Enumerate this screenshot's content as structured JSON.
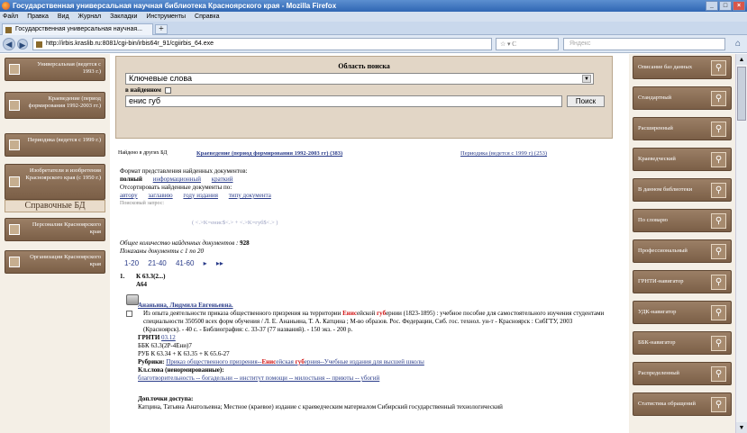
{
  "window": {
    "title": "Государственная универсальная научная библиотека Красноярского края - Mozilla Firefox"
  },
  "menu": [
    "Файл",
    "Правка",
    "Вид",
    "Журнал",
    "Закладки",
    "Инструменты",
    "Справка"
  ],
  "tab": {
    "label": "Государственная универсальная научная..."
  },
  "nav": {
    "url": "http://irbis.kraslib.ru:8081/cgi-bin/irbis64r_91/cgiirbis_64.exe",
    "search_placeholder": "Яндекс"
  },
  "left_nav": {
    "items": [
      "Универсальная (ведется с 1993 г.)",
      "Краеведение (период формирования 1992-2003 гг.)",
      "Периодика (ведется с 1999 г.)",
      "Изобретатели и изобретения Красноярского края (с 1950 г.)"
    ],
    "section_title": "Справочные БД",
    "ref_items": [
      "Персоналии Красноярского края",
      "Организации Красноярского края"
    ]
  },
  "search": {
    "area_title": "Область поиска",
    "field": "Ключевые слова",
    "in_found_label": "в найденном",
    "query": "енис губ",
    "button": "Поиск"
  },
  "stats": {
    "found_label": "Найдено в других БД",
    "db1": "Краеведение (период формирования 1992-2003 гг) (383)",
    "db2": "Периодика (ведется с 1999 г) (253)"
  },
  "format": {
    "label": "Формат представления найденных документов:",
    "options": [
      "полный",
      "информационный",
      "краткий"
    ],
    "sort_label": "Отсортировать найденные документы по:",
    "sort_options": [
      "автору",
      "заглавию",
      "году издания",
      "типу документа"
    ],
    "prev_query_label": "Поисковый запрос:",
    "bool_query": "( <.>K=енис$<.> + <.>K=губ$<.> )"
  },
  "totals": {
    "total_label": "Общее количество найденных документов :",
    "total_value": "928",
    "shown": "Показаны документы с 1 по 20"
  },
  "pager": [
    "1-20",
    "21-40",
    "41-60",
    "▸",
    "▸▸"
  ],
  "record": {
    "num": "1.",
    "shelf1": "К 63.3(2...)",
    "shelf2": "А64",
    "author": "Ананьина, Людмила Евгеньевна.",
    "text_a": "Из опыта деятельности приказа общественного призрения на территории ",
    "hl1": "Енис",
    "text_b": "ейской ",
    "hl2": "губ",
    "text_c": "ернии (1823-1895) : учебное пособие для самостоятельного изучения студентами специальности 350500 всех форм обучения / Л. Е. Ананьина, Т. А. Катцина ; М-во образов. Рос. Федерации, Сиб. гос. технол. ун-т - Красноярск : СибГТУ, 2003 (Красноярск). - 40 с. - Библиография: с. 33-37 (77 названий). - 150 экз. - 200 р.",
    "grnti_label": "ГРНТИ",
    "grnti_val": "03.12",
    "bbk": "ББК 63.3(2Р-4Ени)7",
    "rub": "РУБ К 63.34 + К 63.35 + К 65.6-27",
    "rubrics_label": "Рубрики:",
    "rubrics_a": "Приказ общественного призрения--",
    "rubrics_hl1": "Енис",
    "rubrics_b": "ейская ",
    "rubrics_hl2": "губ",
    "rubrics_c": "ерния--Учебные издания для высшей школы",
    "kw_label": "Кл.слова (ненормированные):",
    "keywords": "благотворительность -- богадельни -- институт помощи -- милостыня -- приюты -- убогий",
    "access_label": "Доп.точки доступа:",
    "access": "Катцина, Татьяна Анатольевна; Местное (краевое) издание с краеведческим материалом Сибирский государственный технологический"
  },
  "right_nav": [
    "Описание баз данных",
    "Стандартный",
    "Расширенный",
    "Краеведческий",
    "В данном библиотеки",
    "По словарю",
    "Профессиональный",
    "ГРНТИ-навигатор",
    "УДК-навигатор",
    "ББК-навигатор",
    "Распределенный",
    "Статистика обращений"
  ]
}
